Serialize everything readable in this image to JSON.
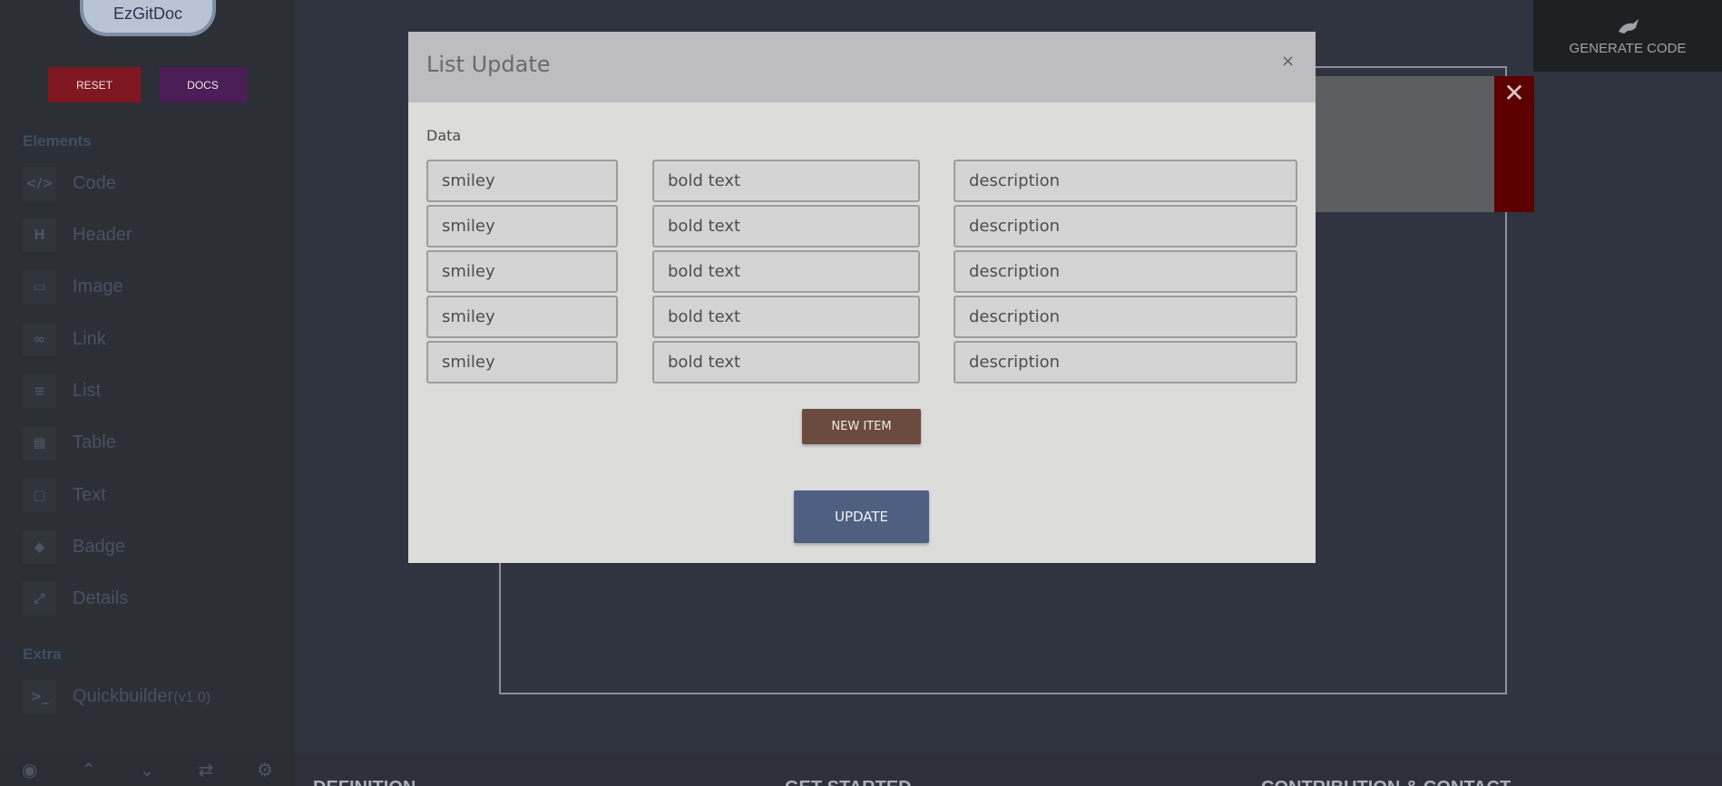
{
  "sidebar": {
    "logo_text": "EzGitDoc",
    "reset_label": "RESET",
    "docs_label": "DOCS",
    "elements_title": "Elements",
    "extra_title": "Extra",
    "items": [
      {
        "label": "Code",
        "icon": "code-icon",
        "glyph": "</>"
      },
      {
        "label": "Header",
        "icon": "header-icon",
        "glyph": "H"
      },
      {
        "label": "Image",
        "icon": "image-icon",
        "glyph": "▭"
      },
      {
        "label": "Link",
        "icon": "link-icon",
        "glyph": "∞"
      },
      {
        "label": "List",
        "icon": "list-icon",
        "glyph": "≡"
      },
      {
        "label": "Table",
        "icon": "table-icon",
        "glyph": "▦"
      },
      {
        "label": "Text",
        "icon": "text-icon",
        "glyph": "▢"
      },
      {
        "label": "Badge",
        "icon": "tag-icon",
        "glyph": "◆"
      },
      {
        "label": "Details",
        "icon": "expand-icon",
        "glyph": "⤢"
      }
    ],
    "extra_items": [
      {
        "label": "Quickbuilder",
        "version": "(v1.0)",
        "icon": "terminal-icon",
        "glyph": ">_"
      }
    ],
    "bottom_icons": [
      "eye-icon",
      "chevrons-up-icon",
      "chevrons-down-icon",
      "exchange-icon",
      "gear-icon"
    ]
  },
  "toolbar": {
    "generate_label": "GENERATE CODE"
  },
  "bottom_strip": {
    "items": [
      "DEFINITION",
      "GET STARTED",
      "CONTRIBUTION & CONTACT"
    ]
  },
  "modal": {
    "title": "List Update",
    "close_glyph": "×",
    "data_label": "Data",
    "rows": [
      {
        "smiley": "smiley",
        "bold": "bold text",
        "description": "description"
      },
      {
        "smiley": "smiley",
        "bold": "bold text",
        "description": "description"
      },
      {
        "smiley": "smiley",
        "bold": "bold text",
        "description": "description"
      },
      {
        "smiley": "smiley",
        "bold": "bold text",
        "description": "description"
      },
      {
        "smiley": "smiley",
        "bold": "bold text",
        "description": "description"
      }
    ],
    "new_item_label": "NEW ITEM",
    "update_label": "UPDATE"
  },
  "colors": {
    "reset": "#7e1720",
    "docs": "#4b1e57",
    "new_item": "#6b4a3f",
    "update": "#4f5f80",
    "close_block": "#5c0000"
  }
}
